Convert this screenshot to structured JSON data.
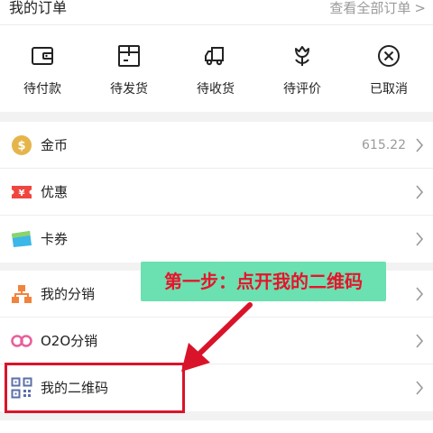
{
  "orders": {
    "title": "我的订单",
    "view_all": "查看全部订单",
    "items": [
      {
        "label": "待付款",
        "icon": "wallet-icon"
      },
      {
        "label": "待发货",
        "icon": "package-icon"
      },
      {
        "label": "待收货",
        "icon": "truck-icon"
      },
      {
        "label": "待评价",
        "icon": "flower-icon"
      },
      {
        "label": "已取消",
        "icon": "cancel-circle-icon"
      }
    ]
  },
  "group1": [
    {
      "label": "金币",
      "value": "615.22",
      "icon": "coin-icon"
    },
    {
      "label": "优惠",
      "value": "",
      "icon": "coupon-icon"
    },
    {
      "label": "卡券",
      "value": "",
      "icon": "card-icon"
    }
  ],
  "group2": [
    {
      "label": "我的分销",
      "icon": "distribution-icon"
    },
    {
      "label": "O2O分销",
      "icon": "o2o-icon"
    },
    {
      "label": "我的二维码",
      "icon": "qr-code-icon"
    }
  ],
  "annotation": {
    "text": "第一步：点开我的二维码"
  },
  "colors": {
    "coin": "#e6b54a",
    "coupon": "#f0463f",
    "card": "#3db6e8",
    "distribution": "#f2833c",
    "o2o": "#e7609b",
    "qr": "#5b6fa8",
    "annotation_bg": "#6be0b0",
    "annotation_text": "#e8132b",
    "highlight": "#d9142a"
  }
}
